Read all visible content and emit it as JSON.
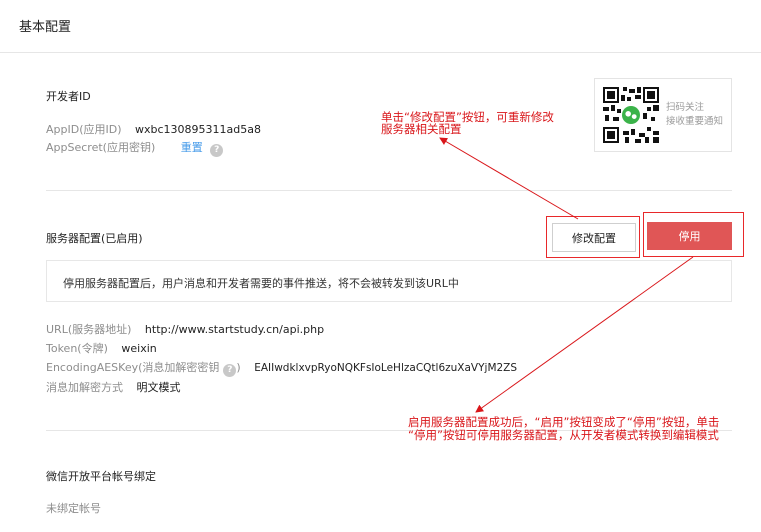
{
  "header": {
    "title": "基本配置"
  },
  "developer": {
    "section_title": "开发者ID",
    "appid_label": "AppID(应用ID)",
    "appid_value": "wxbc130895311ad5a8",
    "secret_label": "AppSecret(应用密钥)",
    "secret_action": "重置"
  },
  "qr": {
    "line1": "扫码关注",
    "line2": "接收重要通知"
  },
  "server": {
    "section_title": "服务器配置(已启用)",
    "edit_button": "修改配置",
    "stop_button": "停用",
    "notice": "停用服务器配置后，用户消息和开发者需要的事件推送，将不会被转发到该URL中",
    "url_label": "URL(服务器地址)",
    "url_value": "http://www.startstudy.cn/api.php",
    "token_label": "Token(令牌)",
    "token_value": "weixin",
    "aes_label": "EncodingAESKey(消息加解密密钥",
    "aes_value": "EAIIwdklxvpRyoNQKFsIoLeHlzaCQtl6zuXaVYjM2ZS",
    "mode_label": "消息加解密方式",
    "mode_value": "明文模式"
  },
  "open_platform": {
    "section_title": "微信开放平台帐号绑定",
    "status": "未绑定帐号"
  },
  "annotations": {
    "top_line1": "单击“修改配置”按钮，可重新修改",
    "top_line2": "服务器相关配置",
    "bottom_line1": "启用服务器配置成功后，“启用”按钮变成了“停用”按钮，单击",
    "bottom_line2": "“停用”按钮可停用服务器配置，从开发者模式转换到编辑模式"
  },
  "colors": {
    "accent_red": "#e05656",
    "annotation_red": "#d9161a",
    "link_blue": "#459ae9"
  }
}
